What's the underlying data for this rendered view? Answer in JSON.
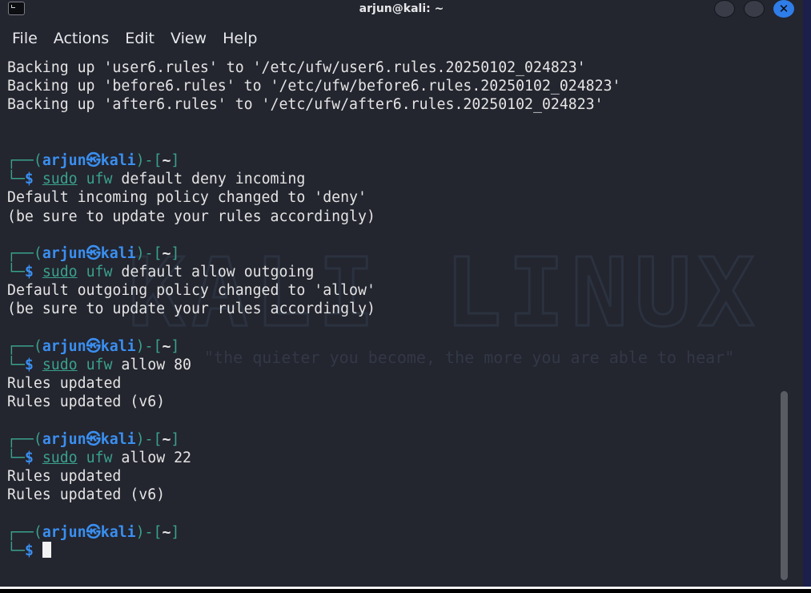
{
  "window": {
    "title": "arjun@kali: ~",
    "controls": {
      "minimize": "",
      "maximize": "",
      "close": "✕"
    }
  },
  "menu": [
    "File",
    "Actions",
    "Edit",
    "View",
    "Help"
  ],
  "background": {
    "watermark": "KALI LINUX",
    "quote": "\"the quieter you become, the more you are able to hear\""
  },
  "terminal": {
    "prompt": {
      "open": "┌──(",
      "user": "arjun",
      "at": "㉿",
      "host": "kali",
      "close": ")-[",
      "path": "~",
      "end": "]",
      "corner": "└─",
      "dollar": "$"
    },
    "backup_lines": [
      "Backing up 'user6.rules' to '/etc/ufw/user6.rules.20250102_024823'",
      "Backing up 'before6.rules' to '/etc/ufw/before6.rules.20250102_024823'",
      "Backing up 'after6.rules' to '/etc/ufw/after6.rules.20250102_024823'"
    ],
    "commands": [
      {
        "sudo": "sudo",
        "cmd": "ufw",
        "args": "default deny incoming",
        "output": [
          "Default incoming policy changed to 'deny'",
          "(be sure to update your rules accordingly)"
        ]
      },
      {
        "sudo": "sudo",
        "cmd": "ufw",
        "args": "default allow outgoing",
        "output": [
          "Default outgoing policy changed to 'allow'",
          "(be sure to update your rules accordingly)"
        ]
      },
      {
        "sudo": "sudo",
        "cmd": "ufw",
        "args": "allow 80",
        "output": [
          "Rules updated",
          "Rules updated (v6)"
        ]
      },
      {
        "sudo": "sudo",
        "cmd": "ufw",
        "args": "allow 22",
        "output": [
          "Rules updated",
          "Rules updated (v6)"
        ]
      }
    ]
  },
  "colors": {
    "background": "#23252f",
    "prompt_bracket": "#3aa18b",
    "prompt_user": "#3a8ff0",
    "close_button": "#2f7de8"
  }
}
